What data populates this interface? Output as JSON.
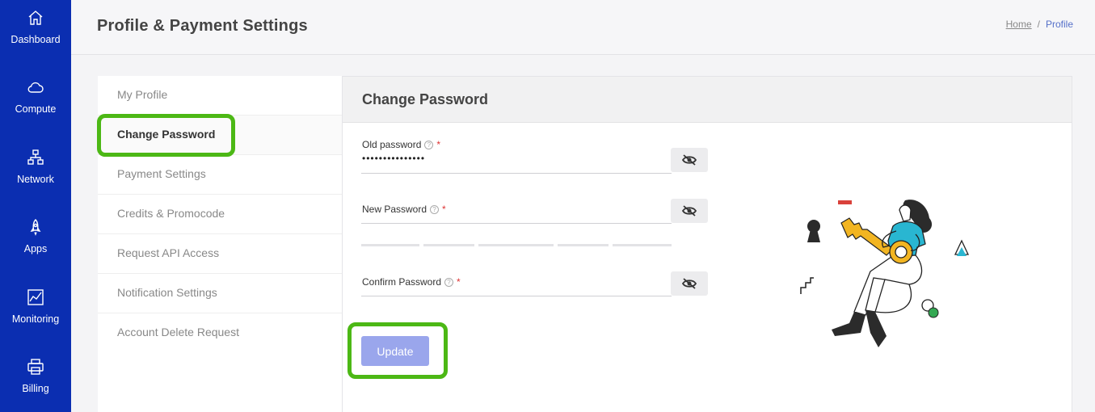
{
  "sidebar": {
    "items": [
      {
        "label": "Dashboard",
        "icon": "home-icon"
      },
      {
        "label": "Compute",
        "icon": "cloud-icon"
      },
      {
        "label": "Network",
        "icon": "network-icon"
      },
      {
        "label": "Apps",
        "icon": "rocket-icon"
      },
      {
        "label": "Monitoring",
        "icon": "chart-icon"
      },
      {
        "label": "Billing",
        "icon": "printer-icon"
      }
    ]
  },
  "header": {
    "title": "Profile & Payment Settings",
    "breadcrumb": {
      "home": "Home",
      "separator": "/",
      "current": "Profile"
    }
  },
  "menu": {
    "items": [
      "My Profile",
      "Change Password",
      "Payment Settings",
      "Credits & Promocode",
      "Request API Access",
      "Notification Settings",
      "Account Delete Request"
    ],
    "active": "Change Password"
  },
  "panel": {
    "title": "Change Password",
    "old_password": {
      "label": "Old password",
      "value": "•••••••••••••••",
      "required": "*",
      "help": "?"
    },
    "new_password": {
      "label": "New Password",
      "value": "",
      "required": "*",
      "help": "?"
    },
    "confirm_password": {
      "label": "Confirm Password",
      "value": "",
      "required": "*",
      "help": "?"
    },
    "update_label": "Update"
  },
  "colors": {
    "sidebar": "#0b2eb1",
    "highlight": "#4cb815",
    "update_button": "#9aa6ec",
    "illustration_accent": "#29b6d1",
    "illustration_key": "#f2b522"
  }
}
